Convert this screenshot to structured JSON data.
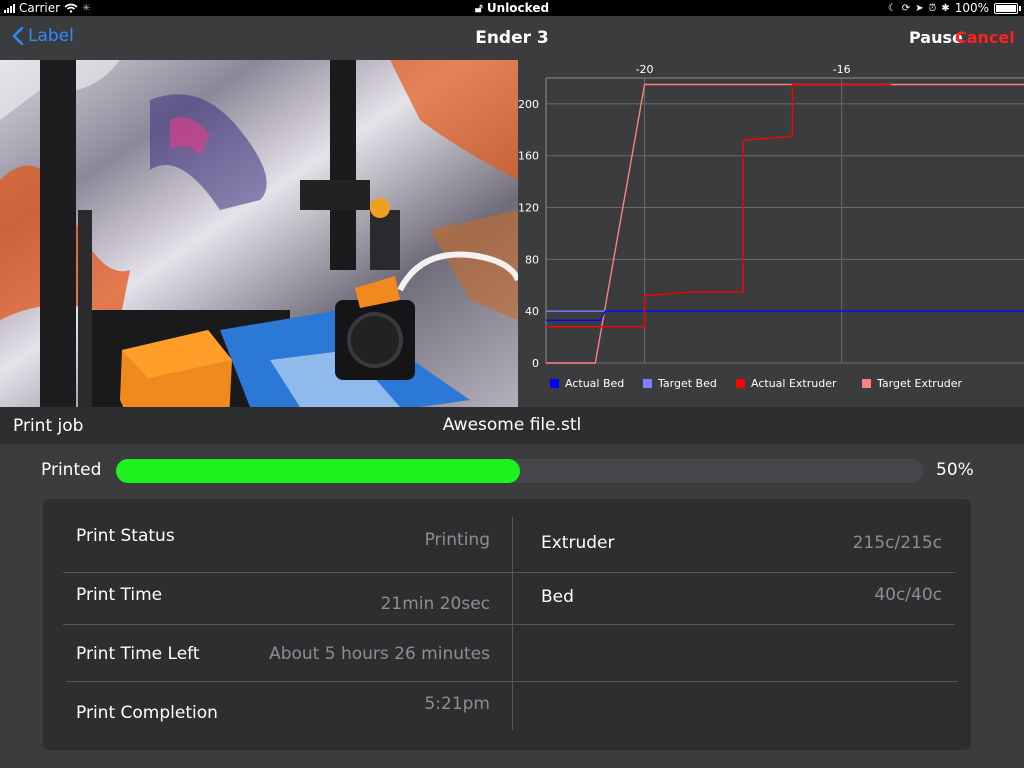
{
  "status_bar": {
    "carrier": "Carrier",
    "lock_text": "Unlocked",
    "battery": "100%"
  },
  "nav": {
    "back_label": "Label",
    "title": "Ender 3",
    "pause_label": "Pause",
    "cancel_label": "Cancel"
  },
  "chart_data": {
    "type": "line",
    "x_ticks": [
      "-20",
      "-16"
    ],
    "y_ticks": [
      "0",
      "40",
      "80",
      "120",
      "160",
      "200"
    ],
    "ylim": [
      0,
      220
    ],
    "xlim": [
      -22,
      -12.3
    ],
    "grid": true,
    "legend_position": "bottom-left",
    "series": [
      {
        "name": "Actual Bed",
        "color": "#0000ff",
        "x": [
          -22,
          -20.9,
          -20.8,
          -12.3
        ],
        "y": [
          33,
          33,
          40,
          40
        ]
      },
      {
        "name": "Target Bed",
        "color": "#8080ff",
        "x": [
          -22,
          -12.3
        ],
        "y": [
          40,
          40
        ]
      },
      {
        "name": "Actual Extruder",
        "color": "#ff0000",
        "x": [
          -22,
          -20,
          -20,
          -19,
          -19,
          -18,
          -18,
          -17,
          -17,
          -15
        ],
        "y": [
          28,
          28,
          52,
          55,
          55,
          55,
          172,
          175,
          215,
          215
        ]
      },
      {
        "name": "Target Extruder",
        "color": "#ff8080",
        "x": [
          -22,
          -21,
          -20,
          -12.3
        ],
        "y": [
          0,
          0,
          215,
          215
        ]
      }
    ]
  },
  "job": {
    "label": "Print job",
    "file": "Awesome file.stl",
    "printed_label": "Printed",
    "progress": 0.5,
    "progress_text": "50%"
  },
  "info": {
    "print_status": {
      "label": "Print Status",
      "value": "Printing"
    },
    "print_time": {
      "label": "Print Time",
      "value": "21min 20sec"
    },
    "print_time_left": {
      "label": "Print Time Left",
      "value": "About 5 hours 26 minutes"
    },
    "print_completion": {
      "label": "Print Completion",
      "value": "5:21pm"
    },
    "extruder": {
      "label": "Extruder",
      "value": "215c/215c"
    },
    "bed": {
      "label": "Bed",
      "value": "40c/40c"
    }
  }
}
